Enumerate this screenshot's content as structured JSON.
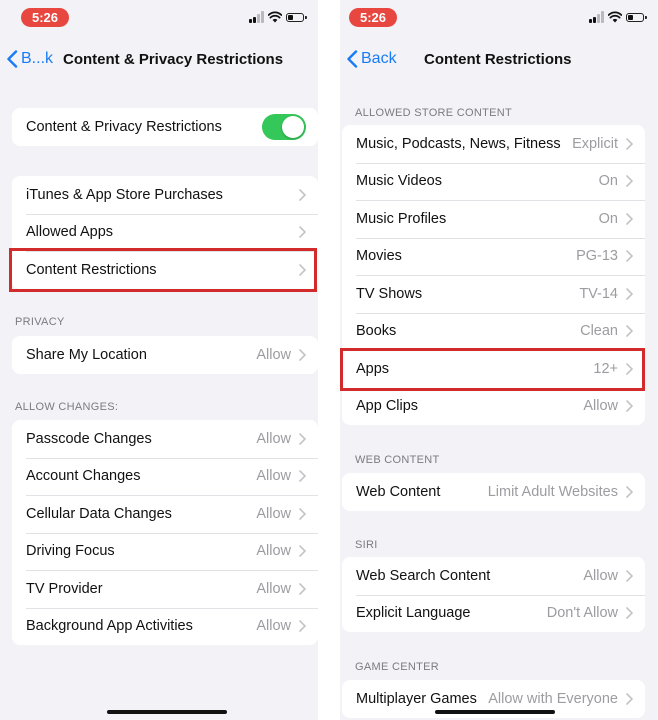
{
  "colors": {
    "accent": "#1a7cf5",
    "toggle_on": "#34c759",
    "time_pill": "#e8473f",
    "highlight": "#d22b2b"
  },
  "left": {
    "time": "5:26",
    "back_label": "B...k",
    "title": "Content & Privacy Restrictions",
    "main_toggle": {
      "label": "Content & Privacy Restrictions",
      "on": true
    },
    "group1": [
      {
        "label": "iTunes & App Store Purchases"
      },
      {
        "label": "Allowed Apps"
      },
      {
        "label": "Content Restrictions"
      }
    ],
    "privacy_header": "PRIVACY",
    "privacy": [
      {
        "label": "Share My Location",
        "value": "Allow"
      }
    ],
    "changes_header": "ALLOW CHANGES:",
    "changes": [
      {
        "label": "Passcode Changes",
        "value": "Allow"
      },
      {
        "label": "Account Changes",
        "value": "Allow"
      },
      {
        "label": "Cellular Data Changes",
        "value": "Allow"
      },
      {
        "label": "Driving Focus",
        "value": "Allow"
      },
      {
        "label": "TV Provider",
        "value": "Allow"
      },
      {
        "label": "Background App Activities",
        "value": "Allow"
      }
    ]
  },
  "right": {
    "time": "5:26",
    "back_label": "Back",
    "title": "Content Restrictions",
    "store_header": "ALLOWED STORE CONTENT",
    "store": [
      {
        "label": "Music, Podcasts, News, Fitness",
        "value": "Explicit"
      },
      {
        "label": "Music Videos",
        "value": "On"
      },
      {
        "label": "Music Profiles",
        "value": "On"
      },
      {
        "label": "Movies",
        "value": "PG-13"
      },
      {
        "label": "TV Shows",
        "value": "TV-14"
      },
      {
        "label": "Books",
        "value": "Clean"
      },
      {
        "label": "Apps",
        "value": "12+"
      },
      {
        "label": "App Clips",
        "value": "Allow"
      }
    ],
    "web_header": "WEB CONTENT",
    "web": [
      {
        "label": "Web Content",
        "value": "Limit Adult Websites"
      }
    ],
    "siri_header": "SIRI",
    "siri": [
      {
        "label": "Web Search Content",
        "value": "Allow"
      },
      {
        "label": "Explicit Language",
        "value": "Don't Allow"
      }
    ],
    "game_header": "GAME CENTER",
    "game": [
      {
        "label": "Multiplayer Games",
        "value": "Allow with Everyone"
      }
    ]
  }
}
